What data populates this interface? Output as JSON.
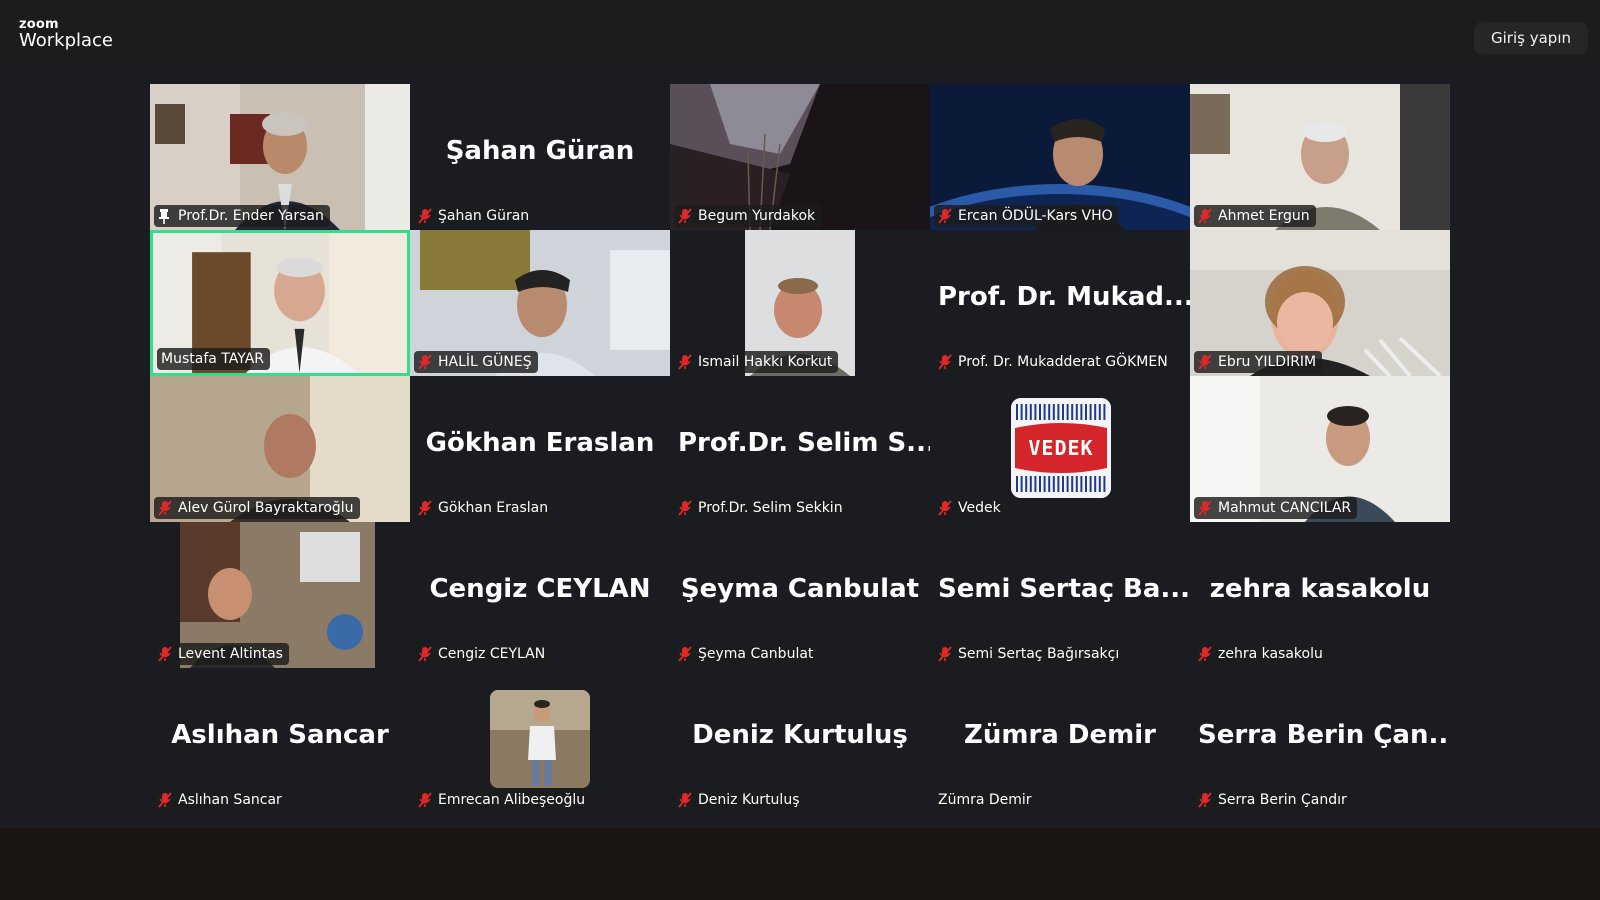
{
  "app": {
    "logo_top": "zoom",
    "logo_main": "Workplace",
    "signin_label": "Giriş yapın"
  },
  "participants": [
    {
      "label": "Prof.Dr. Ender Yarsan",
      "big": "",
      "video": true,
      "mic_off": false,
      "pinned": true
    },
    {
      "label": "Şahan Güran",
      "big": "Şahan Güran",
      "video": false,
      "mic_off": true
    },
    {
      "label": "Begum Yurdakok",
      "big": "",
      "video": true,
      "mic_off": true
    },
    {
      "label": "Ercan ÖDÜL-Kars VHO",
      "big": "",
      "video": true,
      "mic_off": true
    },
    {
      "label": "Ahmet Ergun",
      "big": "",
      "video": true,
      "mic_off": true
    },
    {
      "label": "Mustafa TAYAR",
      "big": "",
      "video": true,
      "mic_off": false,
      "active": true
    },
    {
      "label": "HALİL GÜNEŞ",
      "big": "",
      "video": true,
      "mic_off": true
    },
    {
      "label": "Ismail Hakkı Korkut",
      "big": "",
      "video": true,
      "mic_off": true
    },
    {
      "label": "Prof. Dr. Mukadderat GÖKMEN",
      "big": "Prof. Dr. Mukad...",
      "video": false,
      "mic_off": true
    },
    {
      "label": "Ebru YILDIRIM",
      "big": "",
      "video": true,
      "mic_off": true
    },
    {
      "label": "Alev Gürol Bayraktaroğlu",
      "big": "",
      "video": true,
      "mic_off": true
    },
    {
      "label": "Gökhan Eraslan",
      "big": "Gökhan Eraslan",
      "video": false,
      "mic_off": true
    },
    {
      "label": "Prof.Dr. Selim Sekkin",
      "big": "Prof.Dr. Selim S...",
      "video": false,
      "mic_off": true
    },
    {
      "label": "Vedek",
      "big": "",
      "video": false,
      "mic_off": true,
      "logo_text": "VEDEK"
    },
    {
      "label": "Mahmut CANCILAR",
      "big": "",
      "video": true,
      "mic_off": true
    },
    {
      "label": "Levent Altintas",
      "big": "",
      "video": true,
      "mic_off": true
    },
    {
      "label": "Cengiz CEYLAN",
      "big": "Cengiz CEYLAN",
      "video": false,
      "mic_off": true
    },
    {
      "label": "Şeyma Canbulat",
      "big": "Şeyma Canbulat",
      "video": false,
      "mic_off": true
    },
    {
      "label": "Semi Sertaç Bağırsakçı",
      "big": "Semi Sertaç Ba...",
      "video": false,
      "mic_off": true
    },
    {
      "label": "zehra kasakolu",
      "big": "zehra kasakolu",
      "video": false,
      "mic_off": true
    },
    {
      "label": "Aslıhan Sancar",
      "big": "Aslıhan Sancar",
      "video": false,
      "mic_off": true
    },
    {
      "label": "Emrecan Alibeşeoğlu",
      "big": "",
      "video": false,
      "mic_off": true,
      "thumb": true
    },
    {
      "label": "Deniz Kurtuluş",
      "big": "Deniz Kurtuluş",
      "video": false,
      "mic_off": true
    },
    {
      "label": "Zümra Demir",
      "big": "Zümra Demir",
      "video": false,
      "mic_off": false
    },
    {
      "label": "Serra Berin Çandır",
      "big": "Serra Berin Çan...",
      "video": false,
      "mic_off": true
    }
  ],
  "colors": {
    "active_speaker": "#2ee08d",
    "mic_off": "#e02828"
  }
}
